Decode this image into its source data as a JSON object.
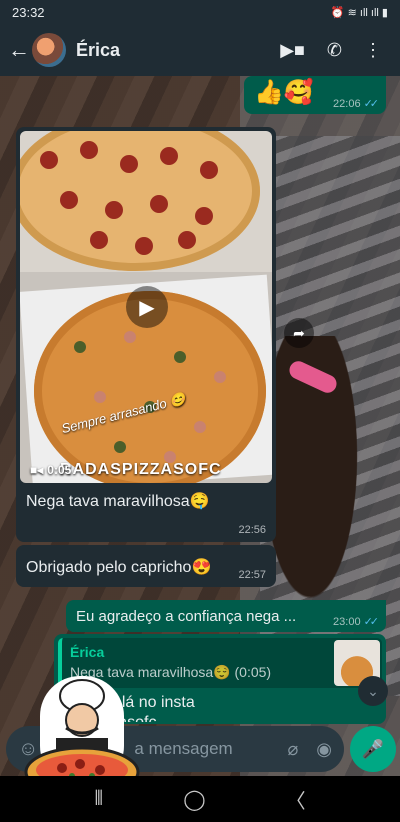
{
  "status_bar": {
    "time": "23:32",
    "indicators": "⏰ ≋ ıll ıll ▮"
  },
  "header": {
    "back_icon": "arrow-left-icon",
    "contact_name": "Érica",
    "actions": [
      "video-call-icon",
      "phone-icon",
      "more-vert-icon"
    ]
  },
  "messages": [
    {
      "direction": "out",
      "text": "👍🥰",
      "time": "22:06",
      "read": true
    },
    {
      "direction": "in",
      "type": "video",
      "duration": "0:05",
      "overlay_text": "Sempre arrasando 😊",
      "overlay_brand": "RADASPIZZASOFC",
      "caption": "Nega tava maravilhosa🤤",
      "time": "22:56"
    },
    {
      "direction": "in",
      "text": "Obrigado pelo capricho😍",
      "time": "22:57"
    },
    {
      "direction": "out",
      "text": "Eu agradeço a confiança nega ...",
      "time": "23:00",
      "read": true
    },
    {
      "direction": "in",
      "quote": {
        "author": "Érica",
        "text": "Nega tava maravilhosa😌 (0:05)"
      },
      "text": "a gente lá no insta",
      "text2": "dasnizzasofc"
    }
  ],
  "composer": {
    "placeholder": "a mensagem"
  },
  "colors": {
    "header_bg": "#1f2c34",
    "bubble_out": "#005c4b",
    "bubble_in": "#202c33",
    "accent": "#00a884",
    "read_ticks": "#53bdeb"
  }
}
